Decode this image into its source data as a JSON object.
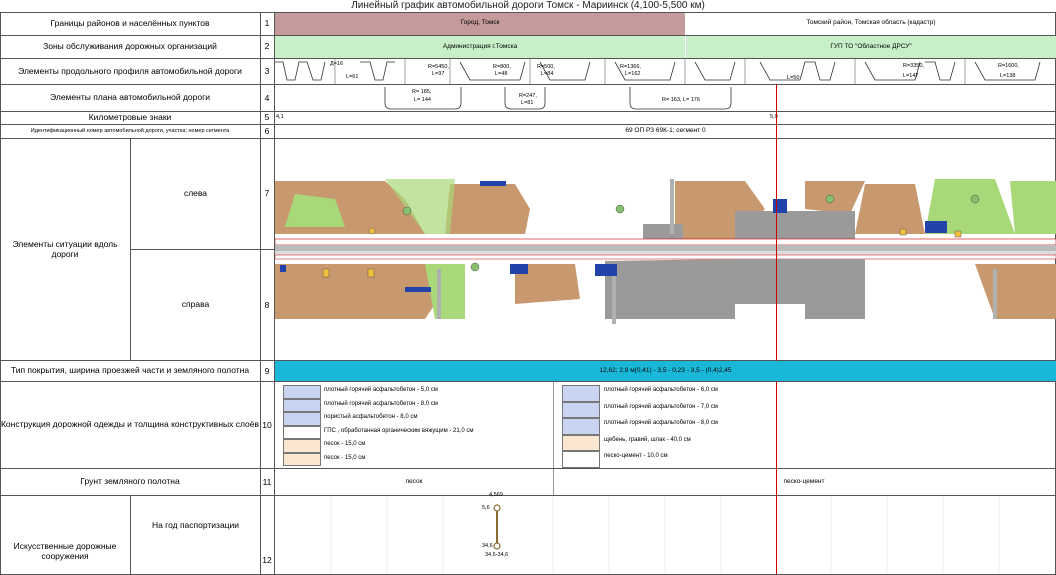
{
  "title": "Линейный график автомобильной дороги Томск - Мариинск (4,100-5,500 км)",
  "rows": [
    {
      "num": "1",
      "label": "Границы районов и населённых пунктов"
    },
    {
      "num": "2",
      "label": "Зоны обслуживания дорожных организаций"
    },
    {
      "num": "3",
      "label": "Элементы продольного профиля автомобильной дороги"
    },
    {
      "num": "4",
      "label": "Элементы плана автомобильной дороги"
    },
    {
      "num": "5",
      "label": "Километровые знаки"
    },
    {
      "num": "6",
      "label": "Идентификационный номер автомобильной дороги, участка; номер сегмента"
    },
    {
      "num": "7",
      "label": "Элементы ситуации вдоль дороги",
      "sub": "слева"
    },
    {
      "num": "8",
      "label": "",
      "sub": "справа"
    },
    {
      "num": "9",
      "label": "Тип покрытия, ширина проезжей части и земляного полотна"
    },
    {
      "num": "10",
      "label": "Конструкция дорожной одежды и толщина конструктивных слоёв"
    },
    {
      "num": "11",
      "label": "Грунт земляного полотна"
    },
    {
      "num": "12",
      "label": "Искусственные дорожные сооружения",
      "sub": "На год паспортизации"
    }
  ],
  "boundaries": {
    "left": "Город, Томск",
    "right": "Томский район, Томская область (кадастр)"
  },
  "zones": {
    "left": "Администрация г.Томска",
    "right": "ГУП ТО \"Областное ДРСУ\""
  },
  "profile": [
    {
      "top": "Д=16",
      "bottom": "L=61"
    },
    {
      "top": "R=5450,",
      "bottom": "L=97"
    },
    {
      "top": "R=800,",
      "bottom": "L=48"
    },
    {
      "top": "R=500,",
      "bottom": "L=84"
    },
    {
      "top": "R=1366,",
      "bottom": "L=162"
    },
    {
      "top": "",
      "bottom": "L=50"
    },
    {
      "top": "R=3350,",
      "bottom": "L=147"
    },
    {
      "top": "R=1600,",
      "bottom": "L=138"
    }
  ],
  "plan": [
    {
      "top": "R= 185,",
      "bottom": "L= 144"
    },
    {
      "top": "R=247,",
      "bottom": "L=81"
    },
    {
      "top": "R= 163, L= 176",
      "bottom": ""
    }
  ],
  "km": {
    "left": "4,1",
    "mid": "5,0"
  },
  "road_id": "69 ОП РЗ 69К-1; сегмент 0",
  "pavement": "12,62; 2,9 м(0,41) - 3,5 - 0,23 - 3,5 - (0,4)2,45",
  "layers_left": [
    {
      "text": "плотный горячий асфальтобетон - 5,0 см",
      "color": "#c8d4f0"
    },
    {
      "text": "плотный горячий асфальтобетон - 8,0 см",
      "color": "#c8d4f0"
    },
    {
      "text": "пористый асфальтобетон - 8,0 см",
      "color": "#c8d4f0"
    },
    {
      "text": "ГПС , обработанная органическим вяжущим - 21,0 см",
      "color": "#ffffff"
    },
    {
      "text": "песок - 15,0 см",
      "color": "#fbe6cf"
    },
    {
      "text": "песок - 15,0 см",
      "color": "#fbe6cf"
    }
  ],
  "layers_right": [
    {
      "text": "плотный горячий асфальтобетон - 6,0 см",
      "color": "#c8d4f0"
    },
    {
      "text": "плотный горячий асфальтобетон - 7,0 см",
      "color": "#c8d4f0"
    },
    {
      "text": "плотный горячий асфальтобетон - 8,0 см",
      "color": "#c8d4f0"
    },
    {
      "text": "щебень, гравий, шлак - 40,0 см",
      "color": "#fbe6cf"
    },
    {
      "text": "песко-цемент - 10,0 см",
      "color": "#ffffff"
    }
  ],
  "soil": {
    "left": "песок",
    "right": "песко-цемент"
  },
  "structure": {
    "top": "4,569",
    "label_left": "5,6",
    "label_mid": "34,6",
    "bottom": "34,6-34,6"
  },
  "colors": {
    "boundary_left": "#c49a9a",
    "zone": "#c8f0c8",
    "pavement": "#1ab8d8",
    "terrain_brown": "#c8996e",
    "terrain_green": "#a8d878",
    "marker_red": "#cc0000"
  }
}
